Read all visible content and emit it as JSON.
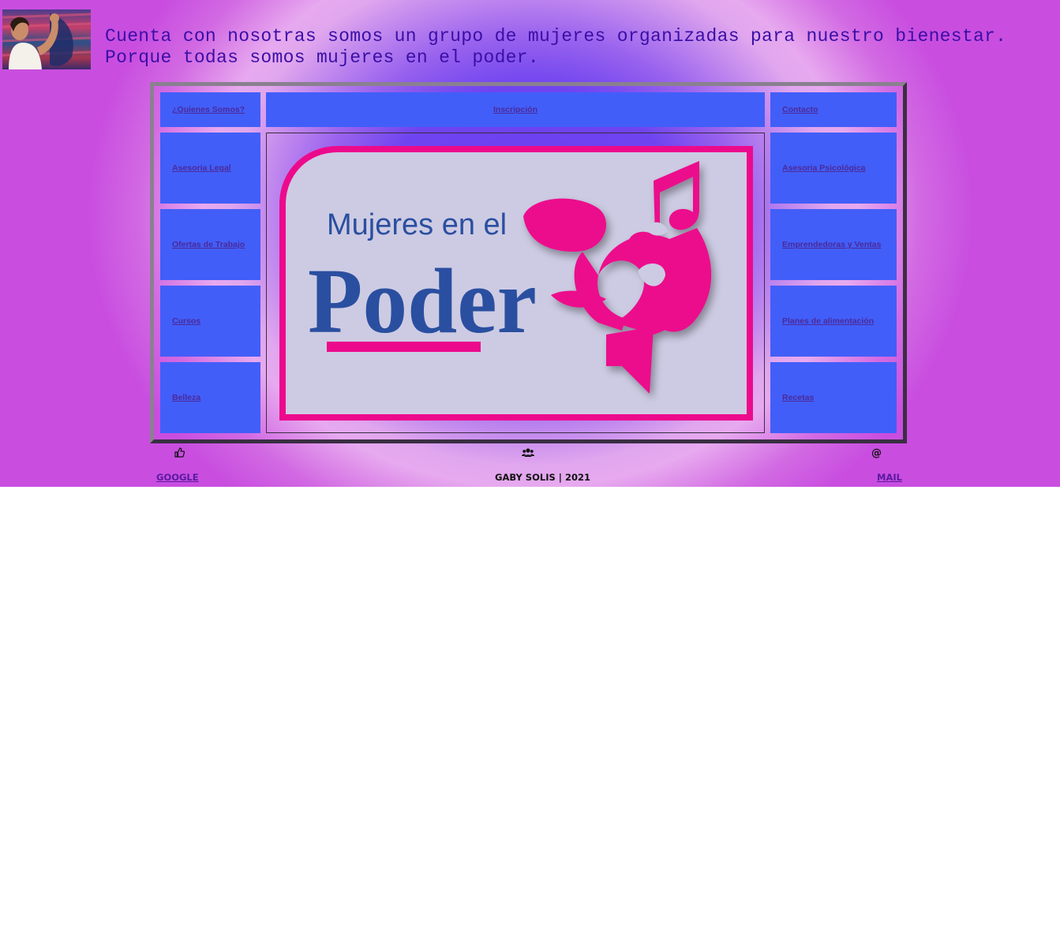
{
  "header": {
    "headline": "Cuenta con nosotras somos un grupo de mujeres organizadas para nuestro bienestar.\nPorque todas somos mujeres en el poder."
  },
  "nav": {
    "quienes_somos": "¿Quienes Somos?",
    "inscripcion": "Inscripción",
    "contacto": "Contacto",
    "left": [
      "Asesoria Legal",
      "Ofertas de Trabajo",
      "Cursos",
      "Belleza"
    ],
    "right": [
      "Asesoria Psicológica",
      "Emprendedoras y Ventas",
      "Planes de alimentación",
      "Recetas"
    ]
  },
  "banner": {
    "line1": "Mujeres en el",
    "line2": "Poder",
    "colors": {
      "pink": "#ec0a8c",
      "blue": "#2a4fa0",
      "panel": "#cdcbe3"
    }
  },
  "footer": {
    "google_icon": "thumbs-up-icon",
    "google_label": "GOOGLE",
    "group_icon": "users-icon",
    "credit": "GABY SOLIS | 2021",
    "mail_icon": "at-sign-icon",
    "mail_symbol": "@",
    "mail_label": "MAIL"
  },
  "colors": {
    "nav_cell": "#425ef8",
    "link": "#4a2a9a",
    "headline": "#3a0fa6"
  }
}
